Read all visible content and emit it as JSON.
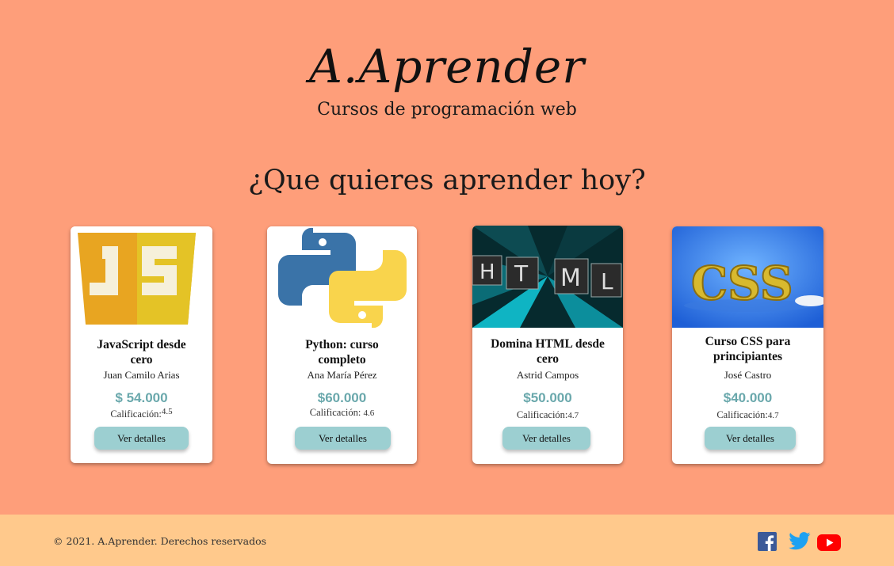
{
  "header": {
    "logo": "A.Aprender",
    "subtitle": "Cursos de programación web"
  },
  "main": {
    "question": "¿Que quieres aprender hoy?",
    "courses": [
      {
        "image": "javascript-logo",
        "title": "JavaScript desde cero",
        "author": "Juan Camilo Arias",
        "price": "$ 54.000",
        "rating_label": "Calificación:",
        "rating_value": "4.5",
        "button": "Ver detalles"
      },
      {
        "image": "python-logo",
        "title": "Python: curso completo",
        "author": "Ana María Pérez",
        "price": "$60.000",
        "rating_label": "Calificación:",
        "rating_value": "4.6",
        "button": "Ver detalles"
      },
      {
        "image": "html-letters",
        "title": "Domina HTML desde cero",
        "author": "Astrid Campos",
        "price": "$50.000",
        "rating_label": "Calificación:",
        "rating_value": "4.7",
        "button": "Ver detalles"
      },
      {
        "image": "css-gold-letters",
        "title": "Curso CSS para principiantes",
        "author": "José Castro",
        "price": "$40.000",
        "rating_label": "Calificación:",
        "rating_value": "4.7",
        "button": "Ver detalles"
      }
    ]
  },
  "footer": {
    "copyright": "© 2021. A.Aprender. Derechos reservados",
    "social": [
      "facebook-icon",
      "twitter-icon",
      "youtube-icon"
    ]
  },
  "colors": {
    "background": "#fe9e7a",
    "footer": "#ffc98c",
    "price": "#6aa8ac",
    "button": "#9ccfd1"
  }
}
